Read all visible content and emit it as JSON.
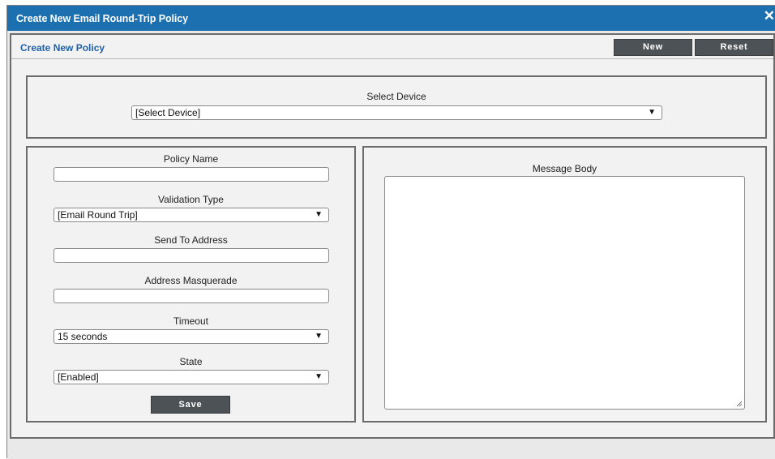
{
  "window": {
    "title": "Create New Email Round-Trip Policy",
    "close_glyph": "✕"
  },
  "panel": {
    "title": "Create New Policy",
    "new_label": "New",
    "reset_label": "Reset"
  },
  "device": {
    "label": "Select Device",
    "value": "[Select Device]"
  },
  "form": {
    "policy_name": {
      "label": "Policy Name",
      "value": ""
    },
    "validation_type": {
      "label": "Validation Type",
      "value": "[Email Round Trip]"
    },
    "send_to": {
      "label": "Send To Address",
      "value": ""
    },
    "masquerade": {
      "label": "Address Masquerade",
      "value": ""
    },
    "timeout": {
      "label": "Timeout",
      "value": "15 seconds"
    },
    "state": {
      "label": "State",
      "value": "[Enabled]"
    },
    "save_label": "Save"
  },
  "message": {
    "label": "Message Body",
    "value": ""
  },
  "colors": {
    "titlebar": "#1d70b0",
    "button": "#4d5256",
    "panel_title": "#2060a8"
  },
  "icons": {
    "close": "close-icon",
    "dropdown": "chevron-down-icon",
    "resize": "resize-grip-icon"
  }
}
